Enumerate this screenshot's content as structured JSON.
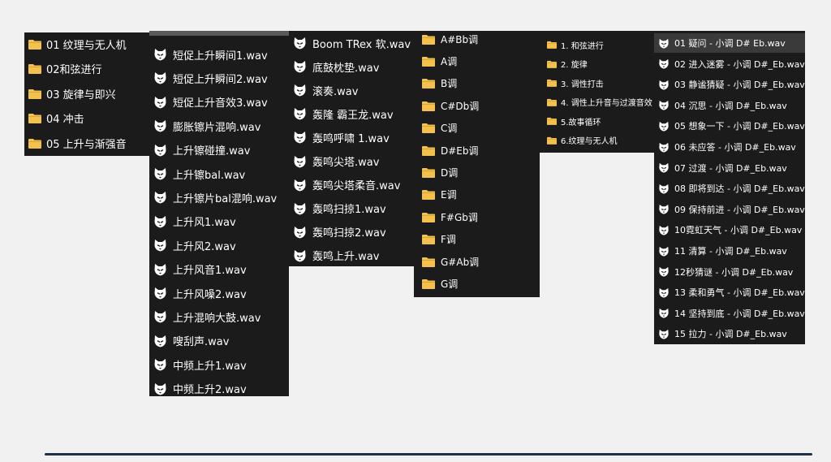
{
  "colors": {
    "background": "#f1f1f1",
    "panel": "#1b1b1b",
    "text": "#ffffff",
    "folder": "#f2c14e",
    "selection": "#3a3a3a",
    "accent_line": "#1f3146"
  },
  "icons": {
    "folder": "folder-icon",
    "audio": "audio-file-icon"
  },
  "panels": [
    {
      "id": "p1",
      "icon": "folder",
      "items": [
        "01 纹理与无人机",
        "02和弦进行",
        "03 旋律与即兴",
        "04 冲击",
        "05 上升与渐强音"
      ]
    },
    {
      "id": "p2",
      "icon": "audio",
      "items": [
        "短促上升瞬间1.wav",
        "短促上升瞬间2.wav",
        "短促上升音效3.wav",
        "膨胀镲片混响.wav",
        "上升镲碰撞.wav",
        "上升镲bal.wav",
        "上升镲片bal混响.wav",
        "上升风1.wav",
        "上升风2.wav",
        "上升风音1.wav",
        "上升风噪2.wav",
        "上升混响大鼓.wav",
        "嗖刮声.wav",
        "中频上升1.wav",
        "中频上升2.wav"
      ]
    },
    {
      "id": "p3",
      "icon": "audio",
      "items": [
        "Boom TRex 软.wav",
        "底鼓枕垫.wav",
        "滚奏.wav",
        "轰隆 霸王龙.wav",
        "轰鸣呼啸 1.wav",
        "轰鸣尖塔.wav",
        "轰鸣尖塔柔音.wav",
        "轰鸣扫掠1.wav",
        "轰鸣扫掠2.wav",
        "轰鸣上升.wav"
      ]
    },
    {
      "id": "p4",
      "icon": "folder",
      "items": [
        "A#Bb调",
        "A调",
        "B调",
        "C#Db调",
        "C调",
        "D#Eb调",
        "D调",
        "E调",
        "F#Gb调",
        "F调",
        "G#Ab调",
        "G调"
      ]
    },
    {
      "id": "p5",
      "icon": "folder",
      "items": [
        "1. 和弦进行",
        "2. 旋律",
        "3. 调性打击",
        "4. 调性上升音与过渡音效",
        "5.故事循环",
        "6.纹理与无人机"
      ]
    },
    {
      "id": "p6",
      "icon": "audio",
      "selected_index": 0,
      "items": [
        "01 疑问 - 小调 D# Eb.wav",
        "02 进入迷雾 - 小调 D#_Eb.wav",
        "03 静谧猜疑 - 小调 D#_Eb.wav",
        "04 沉思 - 小调 D#_Eb.wav",
        "05 想象一下 - 小调 D#_Eb.wav",
        "06 未应答 - 小调 D#_Eb.wav",
        "07 过渡 - 小调 D#_Eb.wav",
        "08 即将到达 - 小调 D#_Eb.wav",
        "09 保持前进 - 小调 D#_Eb.wav",
        "10霓虹天气 - 小调 D#_Eb.wav",
        "11 清算 - 小调 D#_Eb.wav",
        "12秒猜谜 - 小调 D#_Eb.wav",
        "13 柔和勇气 - 小调 D#_Eb.wav",
        "14 坚持到底 - 小调 D#_Eb.wav",
        "15 拉力 - 小调 D#_Eb.wav"
      ]
    }
  ]
}
